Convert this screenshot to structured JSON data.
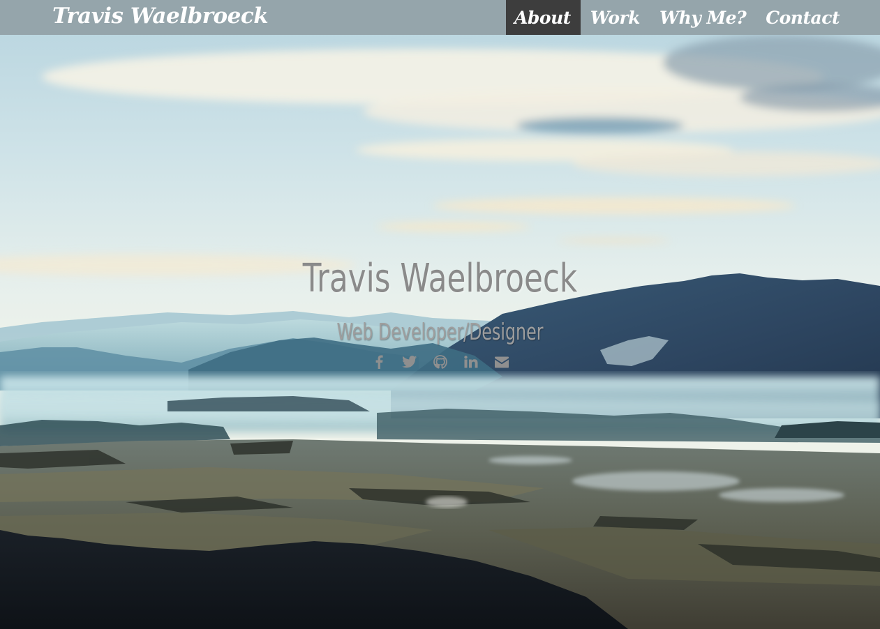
{
  "navbar": {
    "brand": "Travis Waelbroeck",
    "items": [
      {
        "label": "About",
        "active": true
      },
      {
        "label": "Work",
        "active": false
      },
      {
        "label": "Why Me?",
        "active": false
      },
      {
        "label": "Contact",
        "active": false
      }
    ]
  },
  "hero": {
    "title": "Travis Waelbroeck",
    "subtitle": "Web Developer/Designer",
    "social_icons": [
      "facebook-icon",
      "twitter-icon",
      "github-icon",
      "linkedin-icon",
      "envelope-icon"
    ]
  },
  "colors": {
    "navbar_bg": "#95a5ab",
    "nav_active_bg": "#3d3d3d",
    "nav_text": "#ffffff",
    "hero_text": "#8a8a8a",
    "social_icon": "#8f8f8f"
  }
}
